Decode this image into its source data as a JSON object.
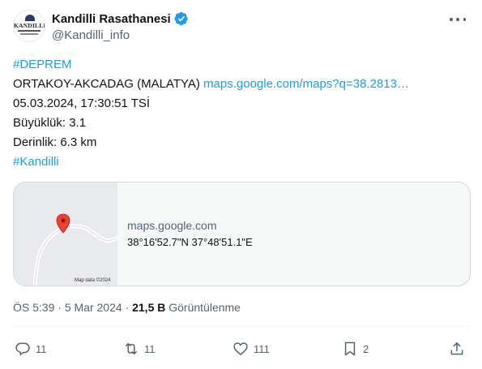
{
  "author": {
    "display_name": "Kandilli Rasathanesi",
    "handle": "@Kandilli_info",
    "avatar_text": "KANDILLI",
    "verified_icon": "verified-badge-icon"
  },
  "tweet": {
    "hashtag1": "#DEPREM",
    "location": "ORTAKOY-AKCADAG (MALATYA)",
    "location_link": "maps.google.com/maps?q=38.2813…",
    "datetime": "05.03.2024, 17:30:51 TSİ",
    "magnitude": "Büyüklük: 3.1",
    "depth": "Derinlik: 6.3 km",
    "hashtag2": "#Kandilli"
  },
  "card": {
    "domain": "maps.google.com",
    "title": "38°16'52.7\"N 37°48'51.1\"E",
    "map_credit": "Map data ©2024"
  },
  "meta": {
    "time": "ÖS 5:39",
    "separator": "·",
    "date": "5 Mar 2024",
    "views_count": "21,5 B",
    "views_label": "Görüntülenme"
  },
  "actions": {
    "replies": "11",
    "retweets": "11",
    "likes": "111",
    "bookmarks": "2"
  },
  "colors": {
    "link": "#1d9bf0",
    "secondary_text": "#536471",
    "primary_text": "#0f1419",
    "map_pin": "#ea4335"
  }
}
